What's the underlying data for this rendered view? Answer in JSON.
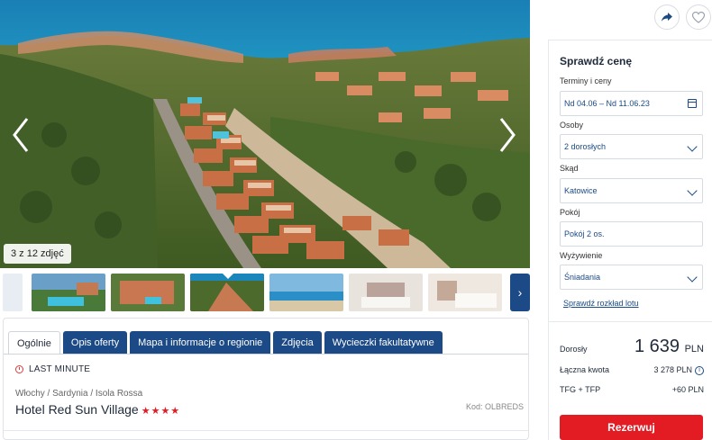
{
  "gallery": {
    "photo_count": "3 z 12 zdjęć",
    "prev_icon": "chevron-left-icon",
    "next_icon": "chevron-right-icon",
    "thumbnails_next_icon": "chevron-right-icon"
  },
  "tabs": [
    {
      "label": "Ogólnie"
    },
    {
      "label": "Opis oferty"
    },
    {
      "label": "Mapa i informacje o regionie"
    },
    {
      "label": "Zdjęcia"
    },
    {
      "label": "Wycieczki fakultatywne"
    }
  ],
  "hotel": {
    "badge": "LAST MINUTE",
    "breadcrumb": "Włochy / Sardynia / Isola Rossa",
    "name": "Hotel Red Sun Village",
    "stars": "★★★★",
    "code": "Kod: OLBREDS"
  },
  "panel": {
    "title": "Sprawdź cenę",
    "dates_label": "Terminy i ceny",
    "dates_value": "Nd 04.06 – Nd 11.06.23",
    "persons_label": "Osoby",
    "persons_value": "2 dorosłych",
    "from_label": "Skąd",
    "from_value": "Katowice",
    "room_label": "Pokój",
    "room_value": "Pokój 2 os.",
    "board_label": "Wyżywienie",
    "board_value": "Śniadania",
    "flight_link": "Sprawdź rozkład lotu",
    "adult_label": "Dorosły",
    "adult_price": "1 639",
    "currency": "PLN",
    "total_label": "Łączna kwota",
    "total_value": "3 278 PLN",
    "fees_label": "TFG + TFP",
    "fees_value": "+60 PLN",
    "book_label": "Rezerwuj"
  },
  "colors": {
    "brand_blue": "#1b4a86",
    "book_red": "#e31b23"
  }
}
